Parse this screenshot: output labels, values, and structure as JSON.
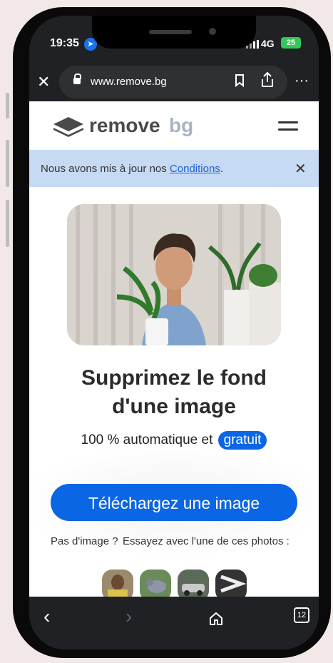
{
  "status": {
    "time": "19:35",
    "network": "4G",
    "battery": "25"
  },
  "browser": {
    "url": "www.remove.bg",
    "tab_count": "12"
  },
  "site": {
    "logo_word1": "remove",
    "logo_word2": "bg",
    "banner_text": "Nous avons mis à jour nos ",
    "banner_link": "Conditions",
    "banner_after": ".",
    "headline_line1": "Supprimez le fond",
    "headline_line2": "d'une image",
    "sub_text": "100 % automatique et ",
    "sub_badge": "gratuit",
    "upload_label": "Téléchargez une image",
    "no_image": "Pas d'image ?",
    "try_photos": "Essayez avec l'une de ces photos :"
  },
  "colors": {
    "accent": "#0a66e4",
    "banner_bg": "#c6daf4",
    "battery": "#34c759"
  },
  "icons": {
    "close": "close-icon",
    "lock": "lock-icon",
    "bookmark": "bookmark-icon",
    "share": "share-icon",
    "more": "more-icon",
    "menu": "hamburger-icon",
    "back": "back-icon",
    "forward": "forward-icon",
    "home": "home-icon",
    "tabs": "tabs-icon"
  }
}
